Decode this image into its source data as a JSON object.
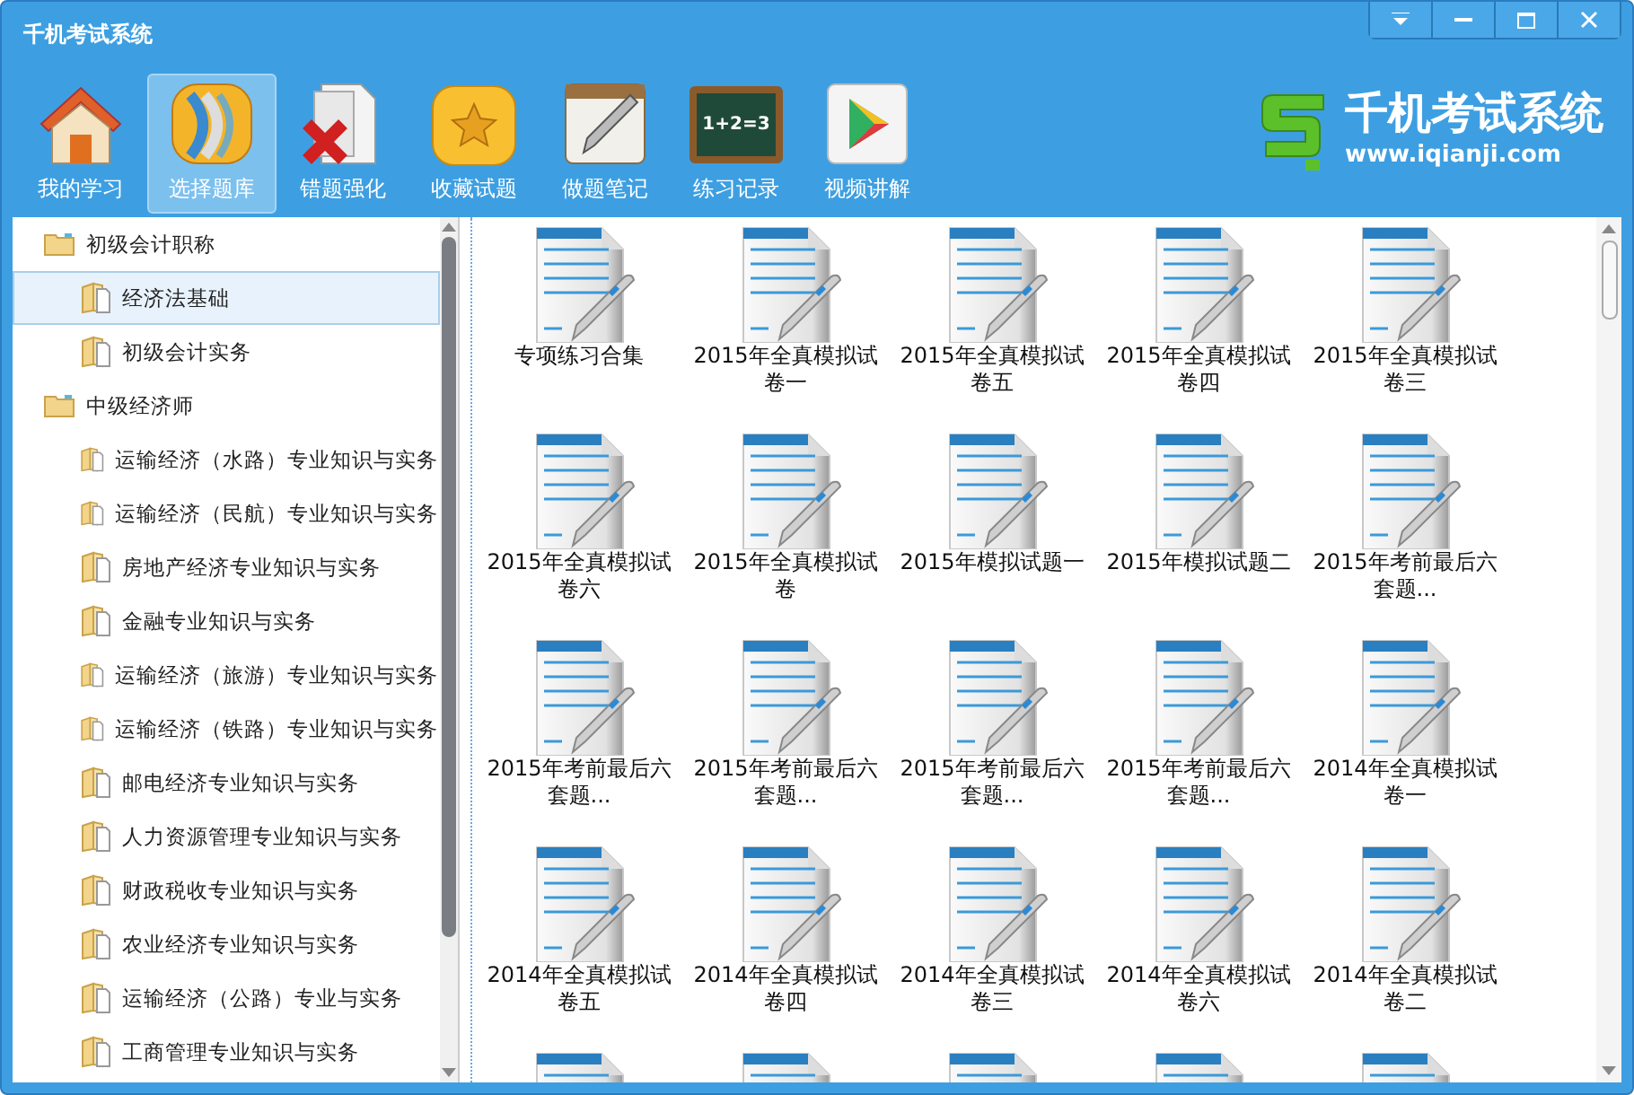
{
  "window": {
    "title": "千机考试系统"
  },
  "toolbar": [
    {
      "kind": "home",
      "label": "我的学习",
      "selected": false
    },
    {
      "kind": "library",
      "label": "选择题库",
      "selected": true
    },
    {
      "kind": "wrong",
      "label": "错题强化",
      "selected": false
    },
    {
      "kind": "favorite",
      "label": "收藏试题",
      "selected": false
    },
    {
      "kind": "notes",
      "label": "做题笔记",
      "selected": false
    },
    {
      "kind": "board",
      "label": "练习记录",
      "selected": false,
      "board_text": "1+2=3"
    },
    {
      "kind": "video",
      "label": "视频讲解",
      "selected": false
    }
  ],
  "logo": {
    "name": "千机考试系统",
    "url": "www.iqianji.com"
  },
  "tree": [
    {
      "label": "初级会计职称",
      "selected": false,
      "children": [
        {
          "label": "经济法基础",
          "selected": true
        },
        {
          "label": "初级会计实务",
          "selected": false
        }
      ]
    },
    {
      "label": "中级经济师",
      "selected": false,
      "children": [
        {
          "label": "运输经济（水路）专业知识与实务",
          "selected": false
        },
        {
          "label": "运输经济（民航）专业知识与实务",
          "selected": false
        },
        {
          "label": "房地产经济专业知识与实务",
          "selected": false
        },
        {
          "label": "金融专业知识与实务",
          "selected": false
        },
        {
          "label": "运输经济（旅游）专业知识与实务",
          "selected": false
        },
        {
          "label": "运输经济（铁路）专业知识与实务",
          "selected": false
        },
        {
          "label": "邮电经济专业知识与实务",
          "selected": false
        },
        {
          "label": "人力资源管理专业知识与实务",
          "selected": false
        },
        {
          "label": "财政税收专业知识与实务",
          "selected": false
        },
        {
          "label": "农业经济专业知识与实务",
          "selected": false
        },
        {
          "label": "运输经济（公路）专业与实务",
          "selected": false
        },
        {
          "label": "工商管理专业知识与实务",
          "selected": false
        }
      ]
    }
  ],
  "papers": [
    {
      "kind": "document",
      "label": "专项练习合集"
    },
    {
      "kind": "document",
      "label": "2015年全真模拟试卷一"
    },
    {
      "kind": "document",
      "label": "2015年全真模拟试卷五"
    },
    {
      "kind": "document",
      "label": "2015年全真模拟试卷四"
    },
    {
      "kind": "document",
      "label": "2015年全真模拟试卷三"
    },
    {
      "kind": "document",
      "label": "2015年全真模拟试卷六"
    },
    {
      "kind": "document",
      "label": "2015年全真模拟试卷"
    },
    {
      "kind": "document",
      "label": "2015年模拟试题一"
    },
    {
      "kind": "document",
      "label": "2015年模拟试题二"
    },
    {
      "kind": "document",
      "label": "2015年考前最后六套题..."
    },
    {
      "kind": "document",
      "label": "2015年考前最后六套题..."
    },
    {
      "kind": "document",
      "label": "2015年考前最后六套题..."
    },
    {
      "kind": "document",
      "label": "2015年考前最后六套题..."
    },
    {
      "kind": "document",
      "label": "2015年考前最后六套题..."
    },
    {
      "kind": "document",
      "label": "2014年全真模拟试卷一"
    },
    {
      "kind": "document",
      "label": "2014年全真模拟试卷五"
    },
    {
      "kind": "document",
      "label": "2014年全真模拟试卷四"
    },
    {
      "kind": "document",
      "label": "2014年全真模拟试卷三"
    },
    {
      "kind": "document",
      "label": "2014年全真模拟试卷六"
    },
    {
      "kind": "document",
      "label": "2014年全真模拟试卷二"
    },
    {
      "kind": "document"
    },
    {
      "kind": "document"
    },
    {
      "kind": "document"
    },
    {
      "kind": "document"
    },
    {
      "kind": "document"
    }
  ]
}
